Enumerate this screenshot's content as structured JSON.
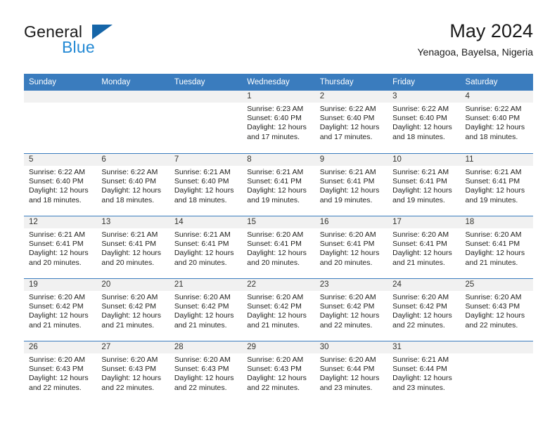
{
  "brand": {
    "name_top": "General",
    "name_bottom": "Blue",
    "triangle_icon": "triangle-icon",
    "accent_color": "#2389d4",
    "triangle_color": "#1565a8"
  },
  "header": {
    "title": "May 2024",
    "subtitle": "Yenagoa, Bayelsa, Nigeria"
  },
  "calendar": {
    "header_color": "#3a7cbe",
    "day_band_color": "#f1f1f1",
    "weekdays": [
      "Sunday",
      "Monday",
      "Tuesday",
      "Wednesday",
      "Thursday",
      "Friday",
      "Saturday"
    ],
    "weeks": [
      [
        {
          "day": "",
          "lines": []
        },
        {
          "day": "",
          "lines": []
        },
        {
          "day": "",
          "lines": []
        },
        {
          "day": "1",
          "lines": [
            "Sunrise: 6:23 AM",
            "Sunset: 6:40 PM",
            "Daylight: 12 hours",
            "and 17 minutes."
          ]
        },
        {
          "day": "2",
          "lines": [
            "Sunrise: 6:22 AM",
            "Sunset: 6:40 PM",
            "Daylight: 12 hours",
            "and 17 minutes."
          ]
        },
        {
          "day": "3",
          "lines": [
            "Sunrise: 6:22 AM",
            "Sunset: 6:40 PM",
            "Daylight: 12 hours",
            "and 18 minutes."
          ]
        },
        {
          "day": "4",
          "lines": [
            "Sunrise: 6:22 AM",
            "Sunset: 6:40 PM",
            "Daylight: 12 hours",
            "and 18 minutes."
          ]
        }
      ],
      [
        {
          "day": "5",
          "lines": [
            "Sunrise: 6:22 AM",
            "Sunset: 6:40 PM",
            "Daylight: 12 hours",
            "and 18 minutes."
          ]
        },
        {
          "day": "6",
          "lines": [
            "Sunrise: 6:22 AM",
            "Sunset: 6:40 PM",
            "Daylight: 12 hours",
            "and 18 minutes."
          ]
        },
        {
          "day": "7",
          "lines": [
            "Sunrise: 6:21 AM",
            "Sunset: 6:40 PM",
            "Daylight: 12 hours",
            "and 18 minutes."
          ]
        },
        {
          "day": "8",
          "lines": [
            "Sunrise: 6:21 AM",
            "Sunset: 6:41 PM",
            "Daylight: 12 hours",
            "and 19 minutes."
          ]
        },
        {
          "day": "9",
          "lines": [
            "Sunrise: 6:21 AM",
            "Sunset: 6:41 PM",
            "Daylight: 12 hours",
            "and 19 minutes."
          ]
        },
        {
          "day": "10",
          "lines": [
            "Sunrise: 6:21 AM",
            "Sunset: 6:41 PM",
            "Daylight: 12 hours",
            "and 19 minutes."
          ]
        },
        {
          "day": "11",
          "lines": [
            "Sunrise: 6:21 AM",
            "Sunset: 6:41 PM",
            "Daylight: 12 hours",
            "and 19 minutes."
          ]
        }
      ],
      [
        {
          "day": "12",
          "lines": [
            "Sunrise: 6:21 AM",
            "Sunset: 6:41 PM",
            "Daylight: 12 hours",
            "and 20 minutes."
          ]
        },
        {
          "day": "13",
          "lines": [
            "Sunrise: 6:21 AM",
            "Sunset: 6:41 PM",
            "Daylight: 12 hours",
            "and 20 minutes."
          ]
        },
        {
          "day": "14",
          "lines": [
            "Sunrise: 6:21 AM",
            "Sunset: 6:41 PM",
            "Daylight: 12 hours",
            "and 20 minutes."
          ]
        },
        {
          "day": "15",
          "lines": [
            "Sunrise: 6:20 AM",
            "Sunset: 6:41 PM",
            "Daylight: 12 hours",
            "and 20 minutes."
          ]
        },
        {
          "day": "16",
          "lines": [
            "Sunrise: 6:20 AM",
            "Sunset: 6:41 PM",
            "Daylight: 12 hours",
            "and 20 minutes."
          ]
        },
        {
          "day": "17",
          "lines": [
            "Sunrise: 6:20 AM",
            "Sunset: 6:41 PM",
            "Daylight: 12 hours",
            "and 21 minutes."
          ]
        },
        {
          "day": "18",
          "lines": [
            "Sunrise: 6:20 AM",
            "Sunset: 6:41 PM",
            "Daylight: 12 hours",
            "and 21 minutes."
          ]
        }
      ],
      [
        {
          "day": "19",
          "lines": [
            "Sunrise: 6:20 AM",
            "Sunset: 6:42 PM",
            "Daylight: 12 hours",
            "and 21 minutes."
          ]
        },
        {
          "day": "20",
          "lines": [
            "Sunrise: 6:20 AM",
            "Sunset: 6:42 PM",
            "Daylight: 12 hours",
            "and 21 minutes."
          ]
        },
        {
          "day": "21",
          "lines": [
            "Sunrise: 6:20 AM",
            "Sunset: 6:42 PM",
            "Daylight: 12 hours",
            "and 21 minutes."
          ]
        },
        {
          "day": "22",
          "lines": [
            "Sunrise: 6:20 AM",
            "Sunset: 6:42 PM",
            "Daylight: 12 hours",
            "and 21 minutes."
          ]
        },
        {
          "day": "23",
          "lines": [
            "Sunrise: 6:20 AM",
            "Sunset: 6:42 PM",
            "Daylight: 12 hours",
            "and 22 minutes."
          ]
        },
        {
          "day": "24",
          "lines": [
            "Sunrise: 6:20 AM",
            "Sunset: 6:42 PM",
            "Daylight: 12 hours",
            "and 22 minutes."
          ]
        },
        {
          "day": "25",
          "lines": [
            "Sunrise: 6:20 AM",
            "Sunset: 6:43 PM",
            "Daylight: 12 hours",
            "and 22 minutes."
          ]
        }
      ],
      [
        {
          "day": "26",
          "lines": [
            "Sunrise: 6:20 AM",
            "Sunset: 6:43 PM",
            "Daylight: 12 hours",
            "and 22 minutes."
          ]
        },
        {
          "day": "27",
          "lines": [
            "Sunrise: 6:20 AM",
            "Sunset: 6:43 PM",
            "Daylight: 12 hours",
            "and 22 minutes."
          ]
        },
        {
          "day": "28",
          "lines": [
            "Sunrise: 6:20 AM",
            "Sunset: 6:43 PM",
            "Daylight: 12 hours",
            "and 22 minutes."
          ]
        },
        {
          "day": "29",
          "lines": [
            "Sunrise: 6:20 AM",
            "Sunset: 6:43 PM",
            "Daylight: 12 hours",
            "and 22 minutes."
          ]
        },
        {
          "day": "30",
          "lines": [
            "Sunrise: 6:20 AM",
            "Sunset: 6:44 PM",
            "Daylight: 12 hours",
            "and 23 minutes."
          ]
        },
        {
          "day": "31",
          "lines": [
            "Sunrise: 6:21 AM",
            "Sunset: 6:44 PM",
            "Daylight: 12 hours",
            "and 23 minutes."
          ]
        },
        {
          "day": "",
          "lines": []
        }
      ]
    ]
  }
}
